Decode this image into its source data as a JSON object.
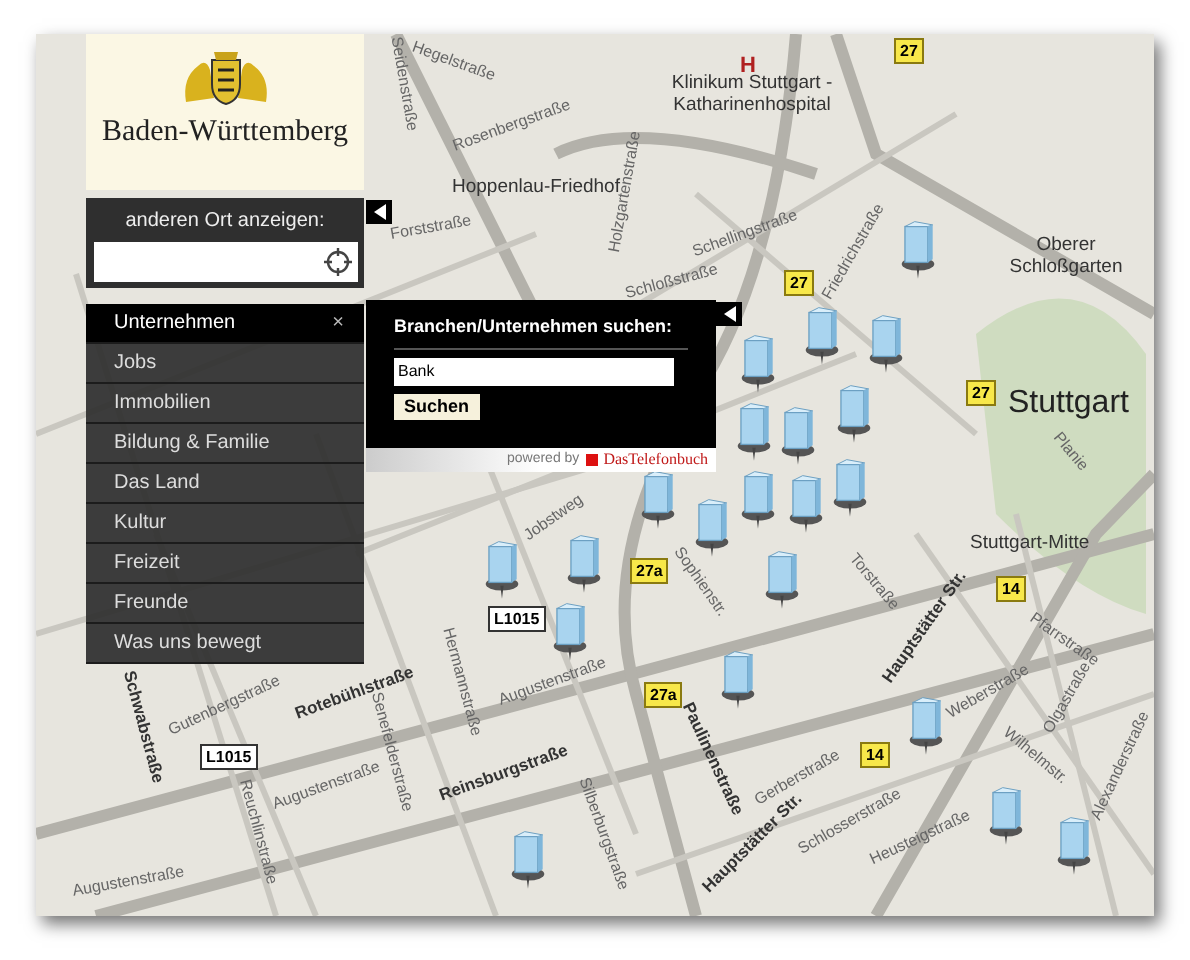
{
  "logo": {
    "name": "Baden-Württemberg"
  },
  "location": {
    "label": "anderen Ort anzeigen:"
  },
  "menu": {
    "close": "×",
    "items": [
      {
        "label": "Unternehmen",
        "selected": true
      },
      {
        "label": "Jobs",
        "selected": false
      },
      {
        "label": "Immobilien",
        "selected": false
      },
      {
        "label": "Bildung & Familie",
        "selected": false
      },
      {
        "label": "Das Land",
        "selected": false
      },
      {
        "label": "Kultur",
        "selected": false
      },
      {
        "label": "Freizeit",
        "selected": false
      },
      {
        "label": "Freunde",
        "selected": false
      },
      {
        "label": "Was uns bewegt",
        "selected": false
      }
    ]
  },
  "search_popup": {
    "title": "Branchen/Unternehmen suchen:",
    "value": "Bank",
    "button": "Suchen",
    "powered_by": "powered by",
    "brand": "DasTelefonbuch"
  },
  "map": {
    "labels": [
      {
        "text": "Hegelstraße",
        "kind": "street"
      },
      {
        "text": "Seidenstraße",
        "kind": "street"
      },
      {
        "text": "Rosenbergstraße",
        "kind": "street"
      },
      {
        "text": "Hoppenlau-Friedhof",
        "kind": "place"
      },
      {
        "text": "Forststraße",
        "kind": "street"
      },
      {
        "text": "H",
        "kind": "hospital"
      },
      {
        "text": "Klinikum Stuttgart - Katharinenhospital",
        "kind": "place"
      },
      {
        "text": "Holzgartenstraße",
        "kind": "street"
      },
      {
        "text": "Schellingstraße",
        "kind": "street"
      },
      {
        "text": "Schloßstraße",
        "kind": "street"
      },
      {
        "text": "Friedrichstraße",
        "kind": "street"
      },
      {
        "text": "Oberer Schloßgarten",
        "kind": "place"
      },
      {
        "text": "Stuttgart",
        "kind": "city"
      },
      {
        "text": "Planie",
        "kind": "street"
      },
      {
        "text": "Stuttgart-Mitte",
        "kind": "place"
      },
      {
        "text": "Pfarrstraße",
        "kind": "street"
      },
      {
        "text": "Olgastraße",
        "kind": "street"
      },
      {
        "text": "Alexanderstraße",
        "kind": "street"
      },
      {
        "text": "Weberstraße",
        "kind": "street"
      },
      {
        "text": "Wilhelmstr.",
        "kind": "street"
      },
      {
        "text": "Hauptstätter Str.",
        "kind": "major"
      },
      {
        "text": "Hauptstätter Str.",
        "kind": "major"
      },
      {
        "text": "Torstraße",
        "kind": "street"
      },
      {
        "text": "Sophienstr.",
        "kind": "street"
      },
      {
        "text": "Paulinenstraße",
        "kind": "major"
      },
      {
        "text": "Gerberstraße",
        "kind": "street"
      },
      {
        "text": "Schlosserstraße",
        "kind": "street"
      },
      {
        "text": "Heusteigstraße",
        "kind": "street"
      },
      {
        "text": "Rotebühlstraße",
        "kind": "major"
      },
      {
        "text": "Reinsburgstraße",
        "kind": "major"
      },
      {
        "text": "Augustenstraße",
        "kind": "street"
      },
      {
        "text": "Augustenstraße",
        "kind": "street"
      },
      {
        "text": "Augustenstraße",
        "kind": "street"
      },
      {
        "text": "Hermannstraße",
        "kind": "street"
      },
      {
        "text": "Senefelderstraße",
        "kind": "street"
      },
      {
        "text": "Schwabstraße",
        "kind": "major"
      },
      {
        "text": "Gutenbergstraße",
        "kind": "street"
      },
      {
        "text": "Reuchlinstraße",
        "kind": "street"
      },
      {
        "text": "Jobstweg",
        "kind": "street"
      },
      {
        "text": "Silberburgstraße",
        "kind": "street"
      }
    ],
    "badges": [
      {
        "text": "27",
        "kind": "federal"
      },
      {
        "text": "27",
        "kind": "federal"
      },
      {
        "text": "27",
        "kind": "federal"
      },
      {
        "text": "27a",
        "kind": "federal"
      },
      {
        "text": "27a",
        "kind": "federal"
      },
      {
        "text": "14",
        "kind": "federal"
      },
      {
        "text": "14",
        "kind": "federal"
      },
      {
        "text": "L1015",
        "kind": "state"
      },
      {
        "text": "L1015",
        "kind": "state"
      }
    ]
  }
}
